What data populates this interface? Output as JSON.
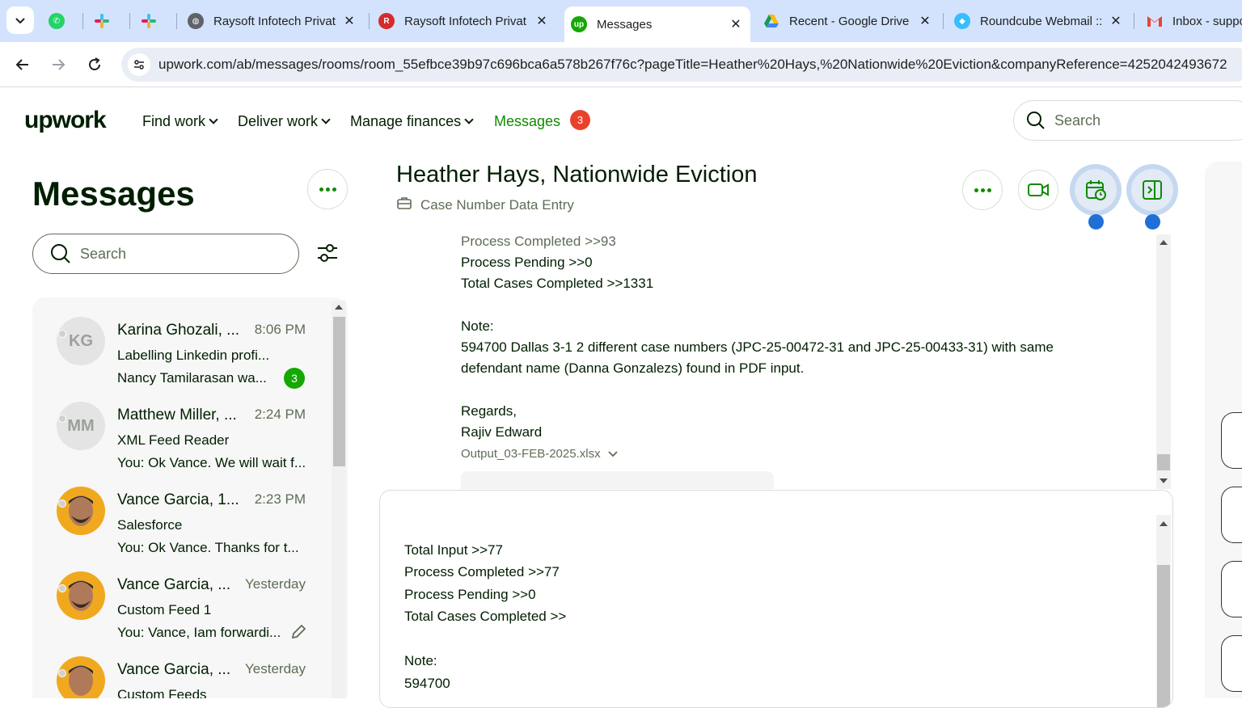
{
  "browser": {
    "tabs": [
      {
        "title": "",
        "icon": "whatsapp-icon"
      },
      {
        "title": "",
        "icon": "slack-icon"
      },
      {
        "title": "",
        "icon": "slack-icon"
      },
      {
        "title": "Raysoft Infotech Privat",
        "icon": "globe-icon"
      },
      {
        "title": "Raysoft Infotech Privat",
        "icon": "raysoft-icon"
      },
      {
        "title": "Messages",
        "icon": "upwork-icon",
        "active": true
      },
      {
        "title": "Recent - Google Drive",
        "icon": "google-drive-icon"
      },
      {
        "title": "Roundcube Webmail ::",
        "icon": "roundcube-icon"
      },
      {
        "title": "Inbox - suppo",
        "icon": "gmail-icon"
      }
    ],
    "url": "upwork.com/ab/messages/rooms/room_55efbce39b97c696bca6a578b267f76c?pageTitle=Heather%20Hays,%20Nationwide%20Eviction&companyReference=4252042493672"
  },
  "header": {
    "logo": "upwork",
    "nav": [
      "Find work",
      "Deliver work",
      "Manage finances"
    ],
    "messages_label": "Messages",
    "messages_count": "3",
    "search_placeholder": "Search"
  },
  "sidebar": {
    "title": "Messages",
    "search_placeholder": "Search",
    "conversations": [
      {
        "initials": "KG",
        "name": "Karina Ghozali, ...",
        "time": "8:06 PM",
        "subject": "Labelling Linkedin profi...",
        "preview": "Nancy Tamilarasan wa...",
        "unread": "3"
      },
      {
        "initials": "MM",
        "name": "Matthew Miller, ...",
        "time": "2:24 PM",
        "subject": "XML Feed Reader",
        "preview": "You: Ok Vance. We will wait f..."
      },
      {
        "initials": "",
        "name": "Vance Garcia, 1...",
        "time": "2:23 PM",
        "subject": "Salesforce",
        "preview": "You: Ok Vance. Thanks for t..."
      },
      {
        "initials": "",
        "name": "Vance Garcia, ...",
        "time": "Yesterday",
        "subject": "Custom Feed 1",
        "preview": "You: Vance, Iam forwardi..."
      },
      {
        "initials": "",
        "name": "Vance Garcia, ...",
        "time": "Yesterday",
        "subject": "Custom Feeds",
        "preview": ""
      }
    ]
  },
  "chat": {
    "title": "Heather Hays, Nationwide Eviction",
    "subtitle": "Case Number Data Entry",
    "thread_lines": [
      "Process Completed >>93",
      "Process Pending >>0",
      "Total Cases Completed >>1331",
      "Note:",
      "594700 Dallas 3-1 2 different case numbers (JPC-25-00472-31 and JPC-25-00433-31) with same",
      "defendant name (Danna Gonzalezs) found in PDF input.",
      "Regards,",
      "Rajiv Edward"
    ],
    "attachment": "Output_03-FEB-2025.xlsx",
    "composer_lines": [
      "Total Input >>77",
      "Process Completed >>77",
      "Process Pending >>0",
      "Total Cases Completed >>",
      "Note:",
      "594700"
    ]
  },
  "colors": {
    "accent": "#108a00",
    "badge": "#e8412c",
    "unread": "#14a800",
    "highlight": "#1f6fd6"
  }
}
